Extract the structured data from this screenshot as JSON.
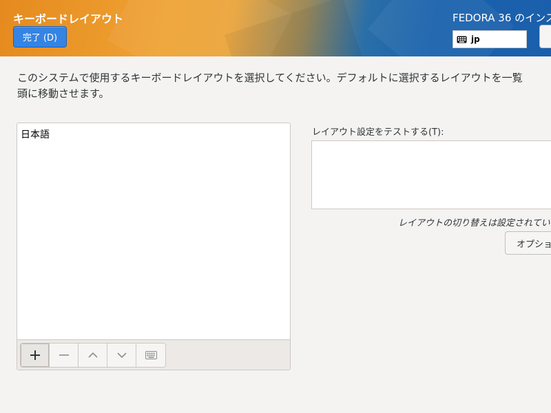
{
  "header": {
    "title": "キーボードレイアウト",
    "done_label": "完了 (D)",
    "product": "FEDORA 36 のインス",
    "keyboard_indicator": "jp"
  },
  "main": {
    "instructions_line1": "このシステムで使用するキーボードレイアウトを選択してください。デフォルトに選択するレイアウトを一覧",
    "instructions_line2": "頭に移動させます。",
    "layouts": [
      "日本語"
    ],
    "toolbar": {
      "buttons": [
        "add-icon",
        "remove-icon",
        "move-up-icon",
        "move-down-icon",
        "keyboard-preview-icon"
      ]
    },
    "test_label": "レイアウト設定をテストする(T):",
    "test_value": "",
    "switch_status": "レイアウトの切り替えは設定されてい",
    "options_label": "オプション"
  },
  "colors": {
    "accent": "#3584e4",
    "header_orange": "#e58a1e",
    "header_blue": "#1a5fac"
  }
}
